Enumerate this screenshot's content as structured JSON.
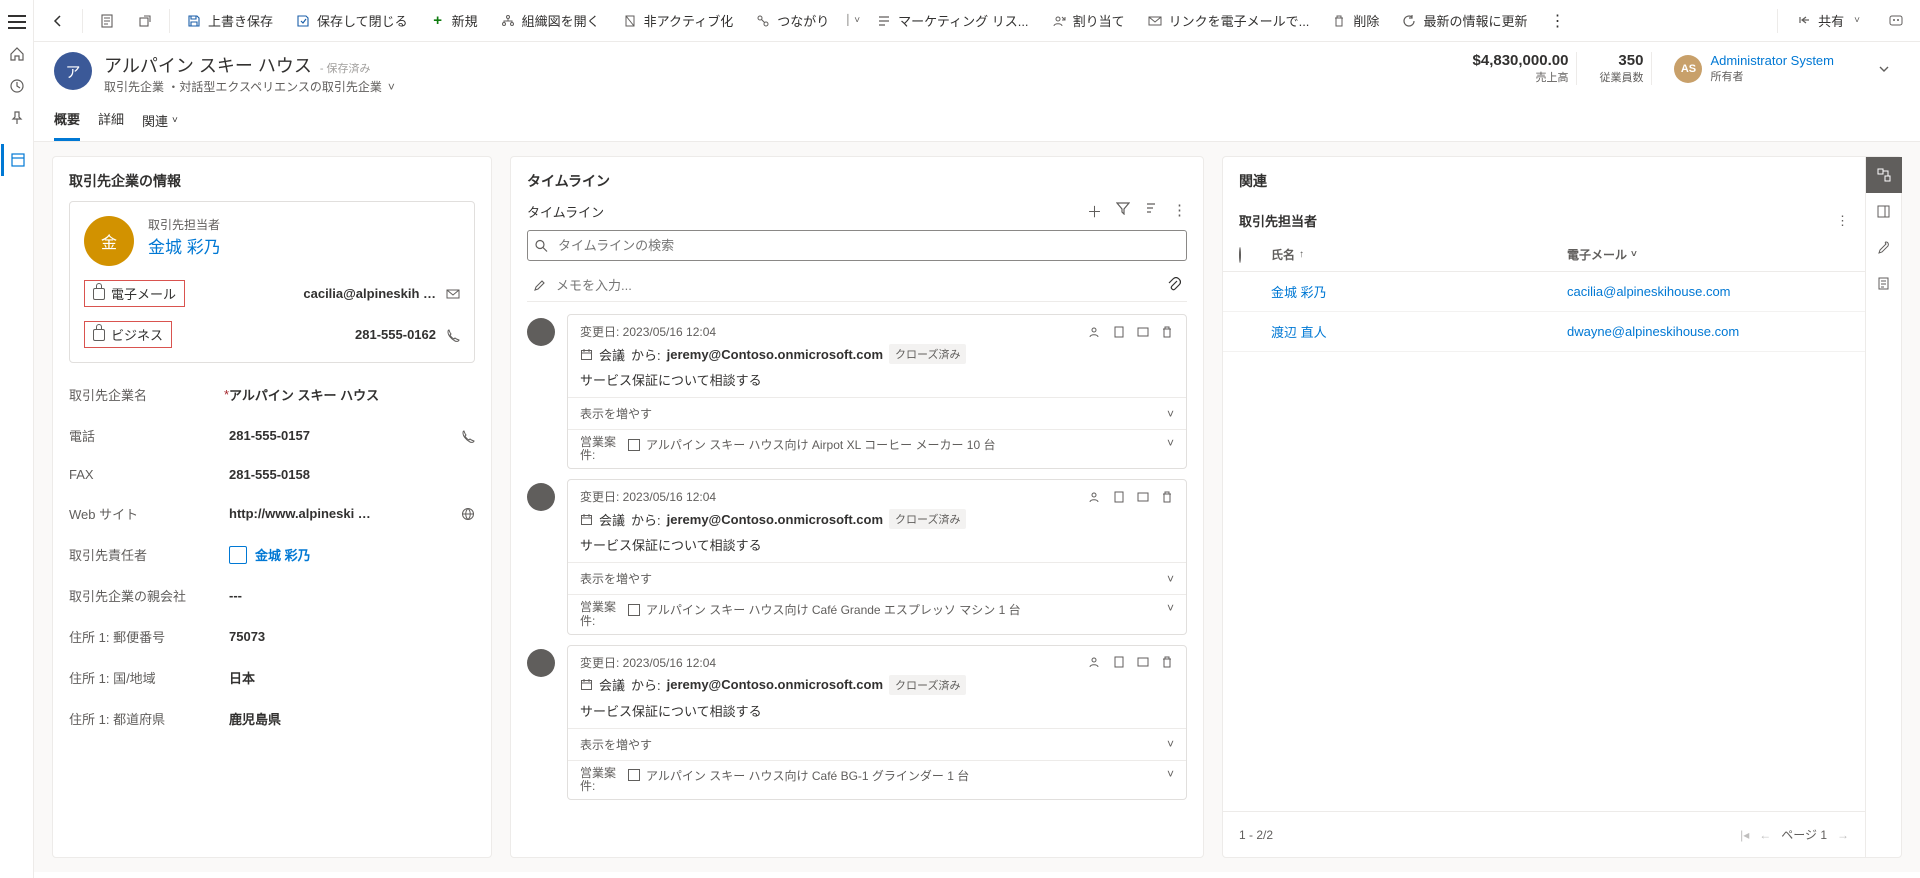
{
  "toolbar": {
    "save": "上書き保存",
    "save_close": "保存して閉じる",
    "new": "新規",
    "open_org": "組織図を開く",
    "deactivate": "非アクティブ化",
    "connection": "つながり",
    "marketing": "マーケティング リス...",
    "assign": "割り当て",
    "email_link": "リンクを電子メールで...",
    "delete": "削除",
    "refresh": "最新の情報に更新",
    "share": "共有"
  },
  "header": {
    "avatar": "ア",
    "title": "アルパイン スキー ハウス",
    "saved": "- 保存済み",
    "subtitle": "取引先企業 ・対話型エクスペリエンスの取引先企業",
    "kpi1_v": "$4,830,000.00",
    "kpi1_l": "売上高",
    "kpi2_v": "350",
    "kpi2_l": "従業員数",
    "owner_initials": "AS",
    "owner_name": "Administrator System",
    "owner_label": "所有者"
  },
  "tabs": {
    "t1": "概要",
    "t2": "詳細",
    "t3": "関連"
  },
  "info": {
    "section": "取引先企業の情報",
    "contact_label": "取引先担当者",
    "contact_avatar": "金",
    "contact_name": "金城 彩乃",
    "email_k": "電子メール",
    "email_v": "cacilia@alpineskih …",
    "biz_k": "ビジネス",
    "biz_v": "281-555-0162",
    "fields": {
      "name_k": "取引先企業名",
      "name_v": "アルパイン スキー ハウス",
      "phone_k": "電話",
      "phone_v": "281-555-0157",
      "fax_k": "FAX",
      "fax_v": "281-555-0158",
      "web_k": "Web サイト",
      "web_v": "http://www.alpineski …",
      "resp_k": "取引先責任者",
      "resp_v": "金城 彩乃",
      "parent_k": "取引先企業の親会社",
      "parent_v": "---",
      "postal_k": "住所 1: 郵便番号",
      "postal_v": "75073",
      "country_k": "住所 1: 国/地域",
      "country_v": "日本",
      "state_k": "住所 1: 都道府県",
      "state_v": "鹿児島県"
    }
  },
  "timeline": {
    "title": "タイムライン",
    "head": "タイムライン",
    "search_ph": "タイムラインの検索",
    "note_ph": "メモを入力...",
    "items": [
      {
        "modified": "変更日: 2023/05/16 12:04",
        "type": "会議",
        "from_l": "から:",
        "from": "jeremy@Contoso.onmicrosoft.com",
        "status": "クローズ済み",
        "subject": "サービス保証について相談する",
        "more": "表示を増やす",
        "oppk": "営業案件:",
        "oppv": "アルパイン スキー ハウス向け Airpot XL コーヒー メーカー 10 台"
      },
      {
        "modified": "変更日: 2023/05/16 12:04",
        "type": "会議",
        "from_l": "から:",
        "from": "jeremy@Contoso.onmicrosoft.com",
        "status": "クローズ済み",
        "subject": "サービス保証について相談する",
        "more": "表示を増やす",
        "oppk": "営業案件:",
        "oppv": "アルパイン スキー ハウス向け Café Grande エスプレッソ マシン 1 台"
      },
      {
        "modified": "変更日: 2023/05/16 12:04",
        "type": "会議",
        "from_l": "から:",
        "from": "jeremy@Contoso.onmicrosoft.com",
        "status": "クローズ済み",
        "subject": "サービス保証について相談する",
        "more": "表示を増やす",
        "oppk": "営業案件:",
        "oppv": "アルパイン スキー ハウス向け Café BG-1 グラインダー 1 台"
      }
    ]
  },
  "related": {
    "title": "関連",
    "sub": "取引先担当者",
    "col1": "氏名",
    "col2": "電子メール",
    "rows": [
      {
        "name": "金城 彩乃",
        "email": "cacilia@alpineskihouse.com"
      },
      {
        "name": "渡辺 直人",
        "email": "dwayne@alpineskihouse.com"
      }
    ],
    "count": "1 - 2/2",
    "page": "ページ 1"
  }
}
